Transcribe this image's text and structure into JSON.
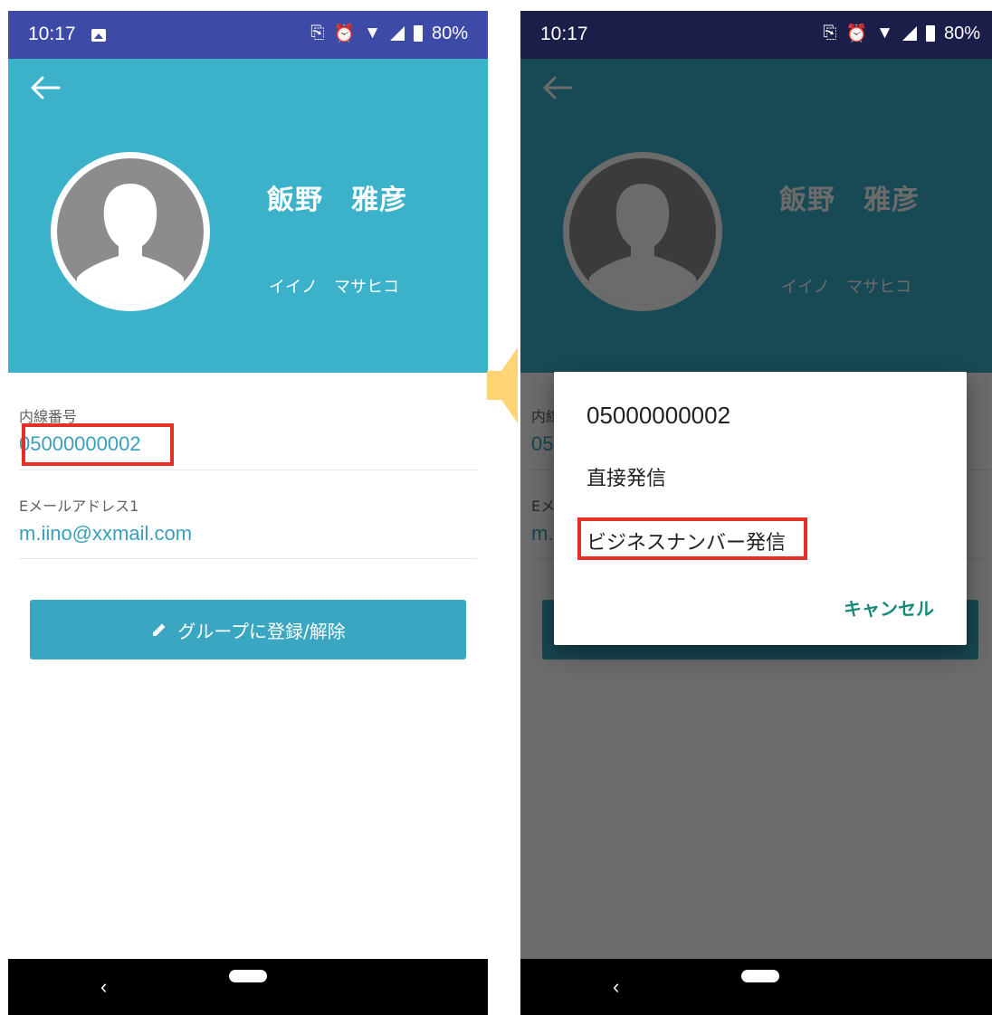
{
  "status": {
    "time": "10:17",
    "battery": "80%"
  },
  "contact": {
    "name_kanji": "飯野　雅彦",
    "name_kana": "イイノ　マサヒコ",
    "extension_label": "内線番号",
    "extension_value": "05000000002",
    "email_label": "Eメールアドレス1",
    "email_value": "m.iino@xxmail.com",
    "group_button_label": "グループに登録/解除"
  },
  "dialog": {
    "title": "05000000002",
    "options": [
      "直接発信",
      "ビジネスナンバー発信"
    ],
    "cancel_label": "キャンセル"
  },
  "icons": [
    "back-arrow-icon",
    "avatar-silhouette-icon",
    "pencil-icon",
    "image-icon",
    "nfc-icon",
    "alarm-icon",
    "wifi-icon",
    "signal-icon",
    "battery-icon",
    "nav-back-icon",
    "nav-home-pill"
  ],
  "colors": {
    "header": "#3bb1ca",
    "accent_text": "#3a9fba",
    "button": "#3ba6c1",
    "status_bar": "#3d4ba6",
    "highlight": "#e63027",
    "cancel": "#17897a",
    "arrow": "#fdd574"
  }
}
